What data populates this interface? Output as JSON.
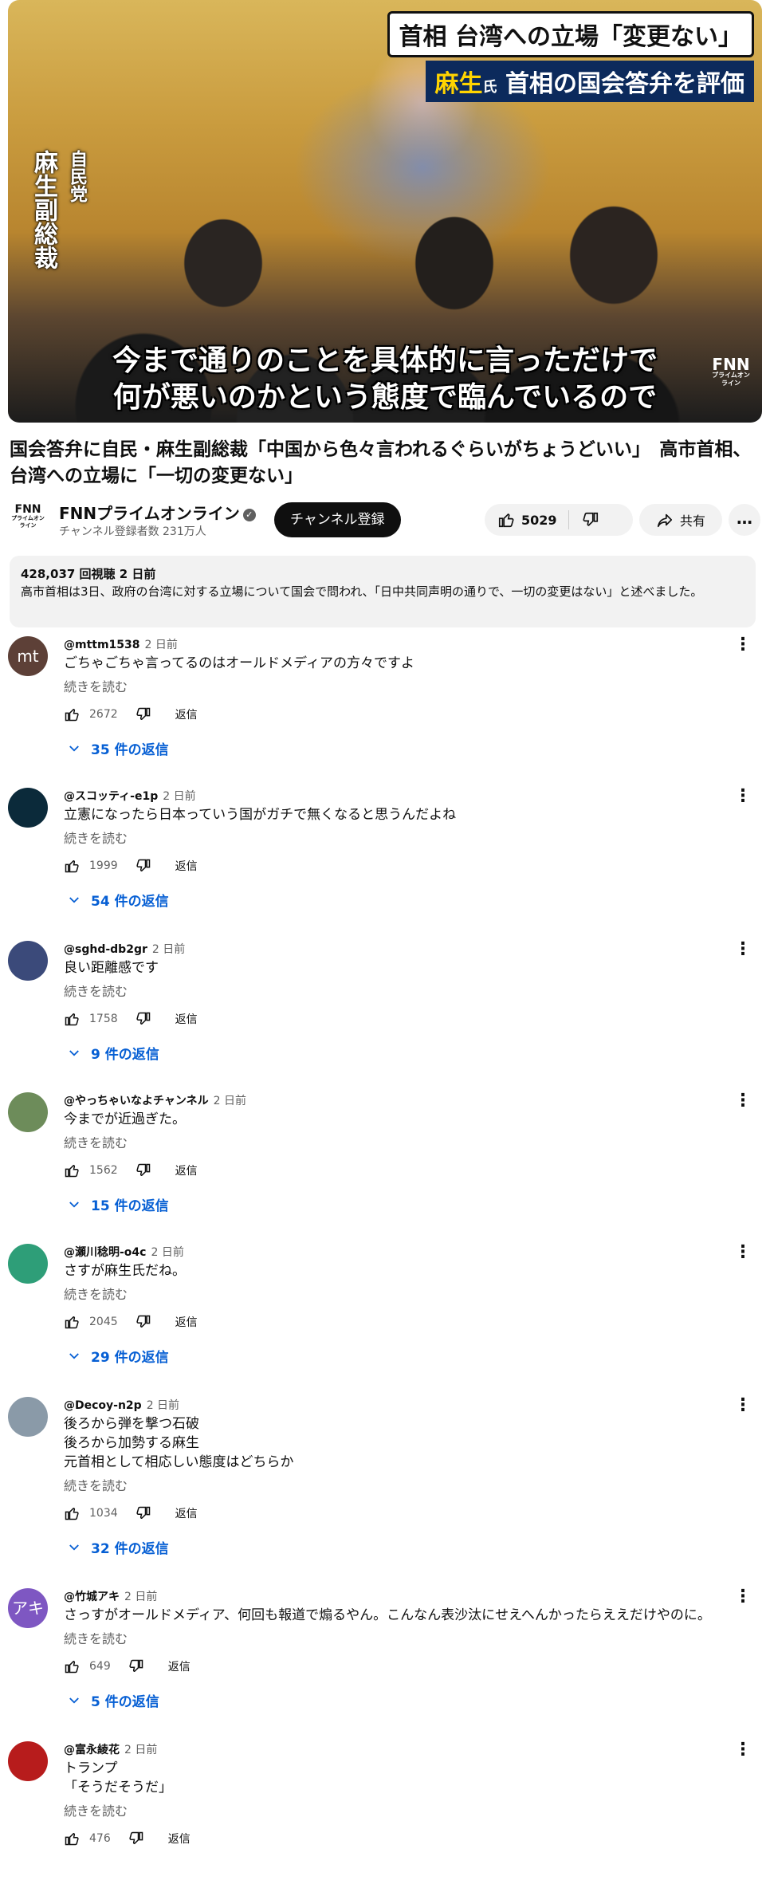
{
  "video": {
    "banner_line1": "首相 台湾への立場「変更ない」",
    "banner_line2_name": "麻生",
    "banner_line2_hon": "氏",
    "banner_line2_rest": "首相の国会答弁を評価",
    "side_label_party": "自民党",
    "side_label_name": "麻生副総裁",
    "subtitle_line1": "今まで通りのことを具体的に言っただけで",
    "subtitle_line2": "何が悪いのかという態度で臨んでいるので",
    "watermark": "FNN",
    "watermark_sub": "プライムオンライン"
  },
  "title": "国会答弁に自民・麻生副総裁「中国から色々言われるぐらいがちょうどいい」　高市首相、台湾への立場に「一切の変更ない」",
  "channel": {
    "logo": "FNN",
    "logo_sub": "プライムオンライン",
    "name": "FNNプライムオンライン",
    "verified_mark": "✓",
    "subscribers": "チャンネル登録者数 231万人",
    "subscribe_label": "チャンネル登録",
    "likes": "5029",
    "share_label": "共有",
    "more_label": "…"
  },
  "description": {
    "stats": "428,037 回視聴  2 日前",
    "text": "高市首相は3日、政府の台湾に対する立場について国会で問われ、「日中共同声明の通りで、一切の変更はない」と述べました。"
  },
  "comment_labels": {
    "read_more": "続きを読む",
    "reply": "返信"
  },
  "comments": [
    {
      "author": "@mttm1538",
      "time": "2 日前",
      "text": "ごちゃごちゃ言ってるのはオールドメディアの方々ですよ",
      "likes": "2672",
      "replies": "35 件の返信",
      "avatar_text": "mt",
      "avatar_color": "#5d4037"
    },
    {
      "author": "@スコッティ-e1p",
      "time": "2 日前",
      "text": "立憲になったら日本っていう国がガチで無くなると思うんだよね",
      "likes": "1999",
      "replies": "54 件の返信",
      "avatar_text": "",
      "avatar_color": "#0b2a3a"
    },
    {
      "author": "@sghd-db2gr",
      "time": "2 日前",
      "text": "良い距離感です",
      "likes": "1758",
      "replies": "9 件の返信",
      "avatar_text": "",
      "avatar_color": "#3b4a7a"
    },
    {
      "author": "@やっちゃいなよチャンネル",
      "time": "2 日前",
      "text": "今までが近過ぎた。",
      "likes": "1562",
      "replies": "15 件の返信",
      "avatar_text": "",
      "avatar_color": "#6d8c5a"
    },
    {
      "author": "@瀬川稔明-o4c",
      "time": "2 日前",
      "text": "さすが麻生氏だね。",
      "likes": "2045",
      "replies": "29 件の返信",
      "avatar_text": "",
      "avatar_color": "#2e9e78"
    },
    {
      "author": "@Decoy-n2p",
      "time": "2 日前",
      "text": "後ろから弾を撃つ石破\n後ろから加勢する麻生\n元首相として相応しい態度はどちらか",
      "likes": "1034",
      "replies": "32 件の返信",
      "avatar_text": "",
      "avatar_color": "#8a9aa8"
    },
    {
      "author": "@竹城アキ",
      "time": "2 日前",
      "text": "さっすがオールドメディア、何回も報道で煽るやん。こんなん表沙汰にせえへんかったらええだけやのに。",
      "likes": "649",
      "replies": "5 件の返信",
      "avatar_text": "アキ",
      "avatar_color": "#7e57c2"
    },
    {
      "author": "@富永綾花",
      "time": "2 日前",
      "text": "トランプ\n「そうだそうだ」",
      "likes": "476",
      "replies": "",
      "avatar_text": "",
      "avatar_color": "#b71c1c"
    }
  ]
}
